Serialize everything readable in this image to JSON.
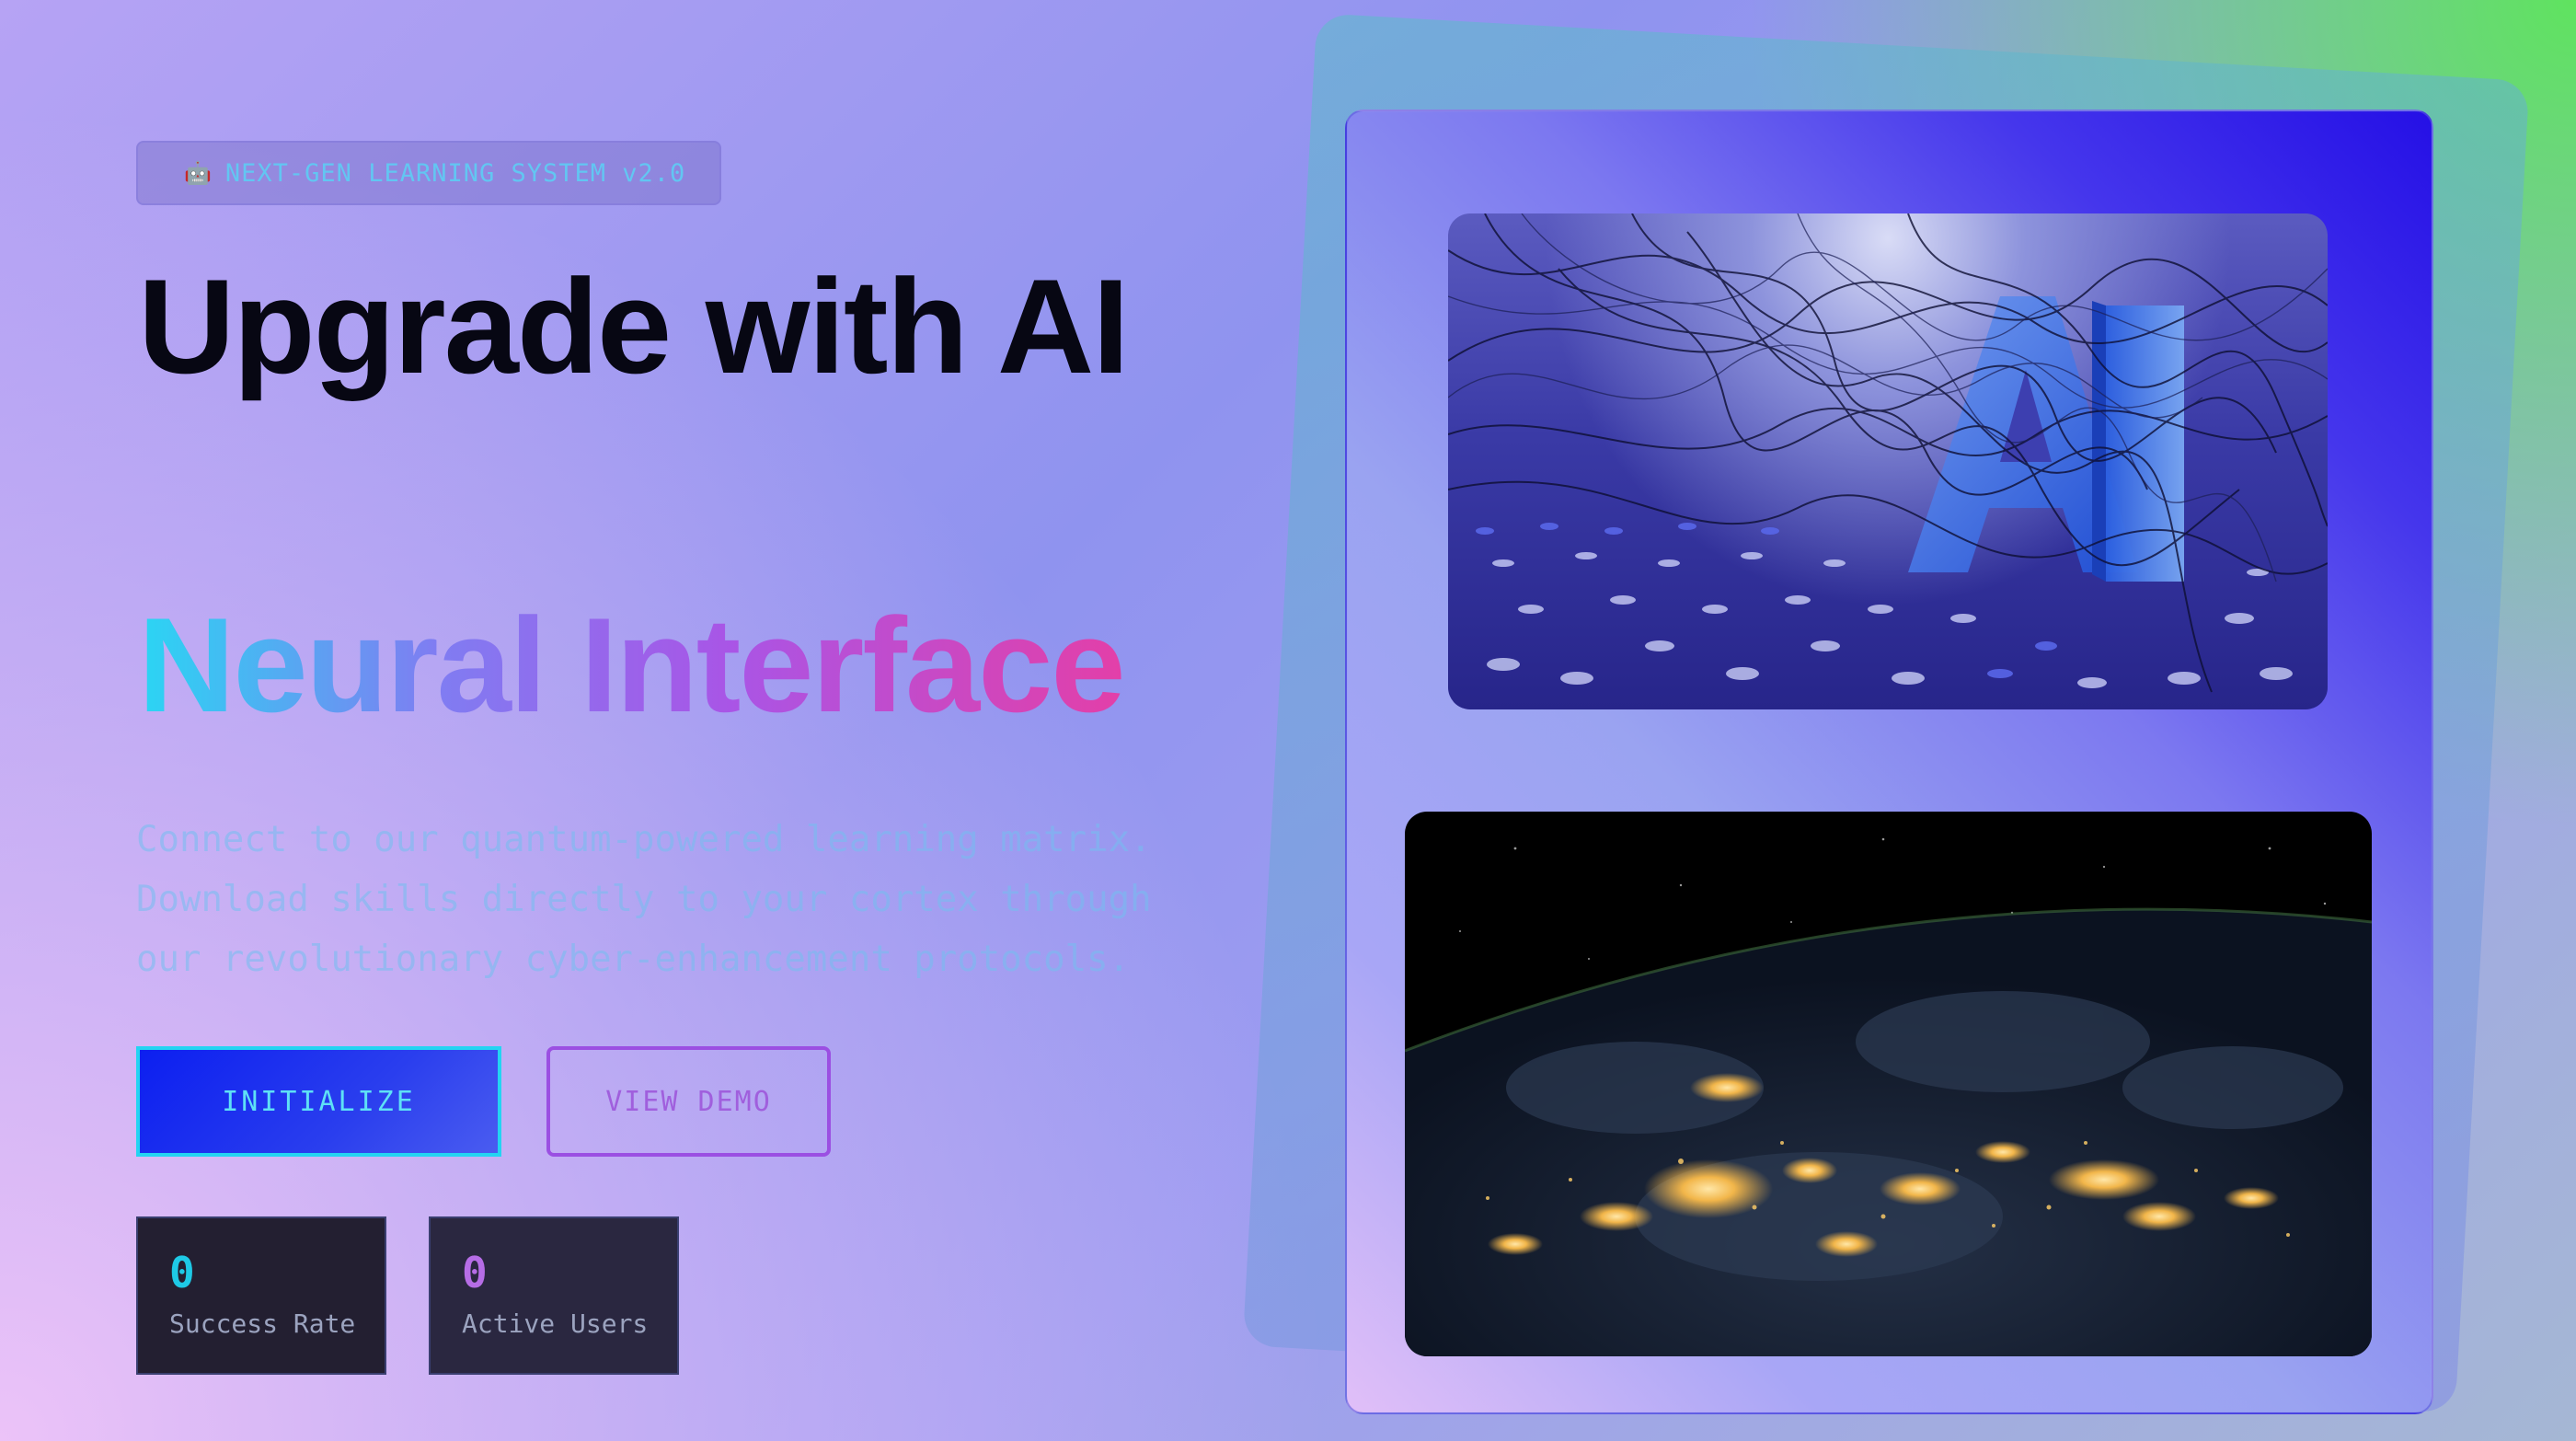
{
  "hero": {
    "badge_icon": "🤖",
    "badge_label": "NEXT-GEN LEARNING SYSTEM v2.0",
    "title": "Upgrade with AI",
    "subtitle": "Neural Interface",
    "description": [
      "Connect to our quantum-powered learning matrix.",
      "Download skills directly to your cortex through",
      "our revolutionary cyber-enhancement protocols."
    ]
  },
  "actions": {
    "primary_label": "INITIALIZE",
    "secondary_label": "VIEW DEMO"
  },
  "stats": [
    {
      "value": "0",
      "label": "Success Rate"
    },
    {
      "value": "0",
      "label": "Active Users"
    }
  ],
  "media": {
    "top_image_icon": "ai-letters-image",
    "bottom_image_icon": "earth-night-image"
  },
  "colors": {
    "accent_cyan": "#23d4f2",
    "accent_purple": "#9b4fe2",
    "button_blue": "#0c1ff0"
  }
}
